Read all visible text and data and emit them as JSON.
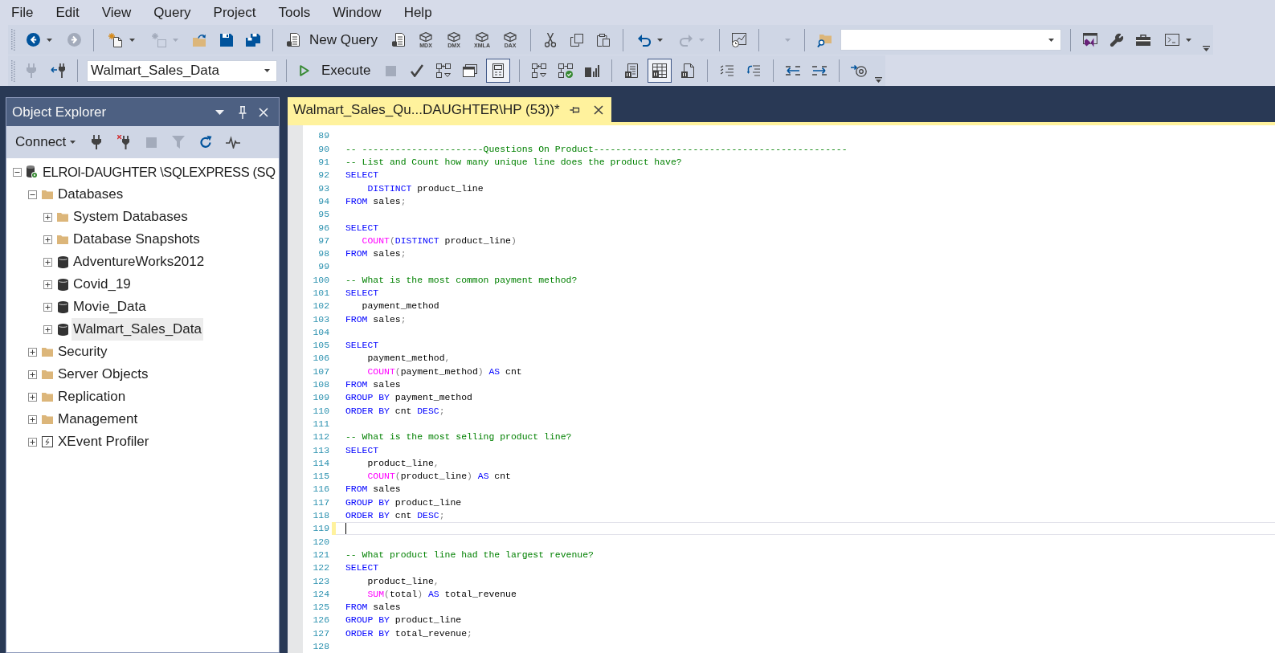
{
  "menu": [
    "File",
    "Edit",
    "View",
    "Query",
    "Project",
    "Tools",
    "Window",
    "Help"
  ],
  "toolbar_1": {
    "buttons": [
      {
        "disabled": false
      },
      {
        "disabled": true
      },
      {
        "disabled": false
      },
      {
        "disabled": true
      },
      {
        "disabled": false
      },
      {
        "disabled": false
      },
      {
        "disabled": false
      },
      {
        "disabled": false
      },
      {
        "disabled": false,
        "label": "MDX"
      },
      {
        "disabled": false,
        "label": "DMX"
      },
      {
        "disabled": false,
        "label": "XMLA"
      },
      {
        "disabled": false,
        "label": "DAX"
      },
      {
        "disabled": false
      },
      {
        "disabled": false
      },
      {
        "disabled": false
      },
      {
        "disabled": false
      },
      {
        "disabled": true
      },
      {
        "disabled": false
      },
      {
        "disabled": true
      },
      {
        "disabled": false
      },
      {
        "disabled": false
      },
      {
        "disabled": false
      },
      {
        "disabled": false
      },
      {
        "disabled": false
      }
    ],
    "new_query": {
      "label": "New Query"
    }
  },
  "toolbar_2": {
    "database": {
      "value": "Walmart_Sales_Data"
    },
    "execute": {
      "label": "Execute"
    },
    "buttons": [
      {
        "disabled": true,
        "pressed": false
      },
      {
        "disabled": false,
        "pressed": false
      },
      {
        "disabled": true,
        "pressed": false
      },
      {
        "disabled": false,
        "pressed": false
      },
      {
        "disabled": false,
        "pressed": false
      },
      {
        "disabled": false,
        "pressed": false
      },
      {
        "disabled": false,
        "pressed": true
      },
      {
        "disabled": false,
        "pressed": false
      },
      {
        "disabled": false,
        "pressed": false
      },
      {
        "disabled": false,
        "pressed": false
      },
      {
        "disabled": false,
        "pressed": false
      },
      {
        "disabled": false,
        "pressed": true
      },
      {
        "disabled": false,
        "pressed": false
      },
      {
        "disabled": false,
        "pressed": false
      },
      {
        "disabled": false,
        "pressed": false
      },
      {
        "disabled": false,
        "pressed": false
      },
      {
        "disabled": false,
        "pressed": false
      },
      {
        "disabled": false,
        "pressed": false
      }
    ]
  },
  "object_explorer": {
    "title": "Object Explorer",
    "connect": {
      "label": "Connect"
    },
    "buttons": [
      {
        "disabled": false
      },
      {
        "disabled": false
      },
      {
        "disabled": true
      },
      {
        "disabled": true
      },
      {
        "disabled": false
      },
      {
        "disabled": false
      }
    ],
    "tree": [
      {
        "label": "ELROI-DAUGHTER \\SQLEXPRESS (SQ",
        "kind": "server",
        "expanded": true,
        "selected": false,
        "children": [
          {
            "label": "Databases",
            "kind": "folder",
            "expanded": true,
            "selected": false,
            "children": [
              {
                "label": "System Databases",
                "kind": "folder",
                "expanded": false,
                "selected": false
              },
              {
                "label": "Database Snapshots",
                "kind": "folder",
                "expanded": false,
                "selected": false
              },
              {
                "label": "AdventureWorks2012",
                "kind": "database",
                "expanded": false,
                "selected": false
              },
              {
                "label": "Covid_19",
                "kind": "database",
                "expanded": false,
                "selected": false
              },
              {
                "label": "Movie_Data",
                "kind": "database",
                "expanded": false,
                "selected": false
              },
              {
                "label": "Walmart_Sales_Data",
                "kind": "database",
                "expanded": false,
                "selected": true
              }
            ]
          },
          {
            "label": "Security",
            "kind": "folder",
            "expanded": false,
            "selected": false
          },
          {
            "label": "Server Objects",
            "kind": "folder",
            "expanded": false,
            "selected": false
          },
          {
            "label": "Replication",
            "kind": "folder",
            "expanded": false,
            "selected": false
          },
          {
            "label": "Management",
            "kind": "folder",
            "expanded": false,
            "selected": false
          },
          {
            "label": "XEvent Profiler",
            "kind": "profiler",
            "expanded": false,
            "selected": false
          }
        ]
      }
    ]
  },
  "editor": {
    "tab": {
      "title": "Walmart_Sales_Qu...DAUGHTER\\HP (53))*"
    },
    "lines": [
      {
        "number": "89",
        "current": false,
        "modified": false
      },
      {
        "number": "90",
        "current": false,
        "modified": false,
        "tokens": [
          {
            "kind": "comment",
            "text": "-- ----------------------Questions On Product----------------------------------------------"
          }
        ]
      },
      {
        "number": "91",
        "current": false,
        "modified": false,
        "tokens": [
          {
            "kind": "comment",
            "text": "-- List and Count how many unique line does the product have?"
          }
        ]
      },
      {
        "number": "92",
        "current": false,
        "modified": false,
        "tokens": [
          {
            "kind": "keyword",
            "text": "SELECT"
          }
        ]
      },
      {
        "number": "93",
        "current": false,
        "modified": false,
        "tokens": [
          {
            "kind": "keyword",
            "text": "    DISTINCT"
          },
          {
            "kind": "plain",
            "text": " product_line"
          }
        ]
      },
      {
        "number": "94",
        "current": false,
        "modified": false,
        "tokens": [
          {
            "kind": "keyword",
            "text": "FROM"
          },
          {
            "kind": "plain",
            "text": " sales"
          },
          {
            "kind": "operator",
            "text": ";"
          }
        ]
      },
      {
        "number": "95",
        "current": false,
        "modified": false
      },
      {
        "number": "96",
        "current": false,
        "modified": false,
        "tokens": [
          {
            "kind": "keyword",
            "text": "SELECT"
          }
        ]
      },
      {
        "number": "97",
        "current": false,
        "modified": false,
        "tokens": [
          {
            "kind": "function",
            "text": "   COUNT"
          },
          {
            "kind": "operator",
            "text": "("
          },
          {
            "kind": "keyword",
            "text": "DISTINCT"
          },
          {
            "kind": "plain",
            "text": " product_line"
          },
          {
            "kind": "operator",
            "text": ")"
          }
        ]
      },
      {
        "number": "98",
        "current": false,
        "modified": false,
        "tokens": [
          {
            "kind": "keyword",
            "text": "FROM"
          },
          {
            "kind": "plain",
            "text": " sales"
          },
          {
            "kind": "operator",
            "text": ";"
          }
        ]
      },
      {
        "number": "99",
        "current": false,
        "modified": false
      },
      {
        "number": "100",
        "current": false,
        "modified": false,
        "tokens": [
          {
            "kind": "comment",
            "text": "-- What is the most common payment method?"
          }
        ]
      },
      {
        "number": "101",
        "current": false,
        "modified": false,
        "tokens": [
          {
            "kind": "keyword",
            "text": "SELECT"
          }
        ]
      },
      {
        "number": "102",
        "current": false,
        "modified": false,
        "tokens": [
          {
            "kind": "plain",
            "text": "   payment_method"
          }
        ]
      },
      {
        "number": "103",
        "current": false,
        "modified": false,
        "tokens": [
          {
            "kind": "keyword",
            "text": "FROM"
          },
          {
            "kind": "plain",
            "text": " sales"
          },
          {
            "kind": "operator",
            "text": ";"
          }
        ]
      },
      {
        "number": "104",
        "current": false,
        "modified": false
      },
      {
        "number": "105",
        "current": false,
        "modified": false,
        "tokens": [
          {
            "kind": "keyword",
            "text": "SELECT"
          }
        ]
      },
      {
        "number": "106",
        "current": false,
        "modified": false,
        "tokens": [
          {
            "kind": "plain",
            "text": "    payment_method"
          },
          {
            "kind": "operator",
            "text": ","
          }
        ]
      },
      {
        "number": "107",
        "current": false,
        "modified": false,
        "tokens": [
          {
            "kind": "function",
            "text": "    COUNT"
          },
          {
            "kind": "operator",
            "text": "("
          },
          {
            "kind": "plain",
            "text": "payment_method"
          },
          {
            "kind": "operator",
            "text": ")"
          },
          {
            "kind": "keyword",
            "text": " AS"
          },
          {
            "kind": "plain",
            "text": " cnt"
          }
        ]
      },
      {
        "number": "108",
        "current": false,
        "modified": false,
        "tokens": [
          {
            "kind": "keyword",
            "text": "FROM"
          },
          {
            "kind": "plain",
            "text": " sales"
          }
        ]
      },
      {
        "number": "109",
        "current": false,
        "modified": false,
        "tokens": [
          {
            "kind": "keyword",
            "text": "GROUP BY"
          },
          {
            "kind": "plain",
            "text": " payment_method"
          }
        ]
      },
      {
        "number": "110",
        "current": false,
        "modified": false,
        "tokens": [
          {
            "kind": "keyword",
            "text": "ORDER BY"
          },
          {
            "kind": "plain",
            "text": " cnt"
          },
          {
            "kind": "keyword",
            "text": " DESC"
          },
          {
            "kind": "operator",
            "text": ";"
          }
        ]
      },
      {
        "number": "111",
        "current": false,
        "modified": false
      },
      {
        "number": "112",
        "current": false,
        "modified": false,
        "tokens": [
          {
            "kind": "comment",
            "text": "-- What is the most selling product line?"
          }
        ]
      },
      {
        "number": "113",
        "current": false,
        "modified": false,
        "tokens": [
          {
            "kind": "keyword",
            "text": "SELECT"
          }
        ]
      },
      {
        "number": "114",
        "current": false,
        "modified": false,
        "tokens": [
          {
            "kind": "plain",
            "text": "    product_line"
          },
          {
            "kind": "operator",
            "text": ","
          }
        ]
      },
      {
        "number": "115",
        "current": false,
        "modified": false,
        "tokens": [
          {
            "kind": "function",
            "text": "    COUNT"
          },
          {
            "kind": "operator",
            "text": "("
          },
          {
            "kind": "plain",
            "text": "product_line"
          },
          {
            "kind": "operator",
            "text": ")"
          },
          {
            "kind": "keyword",
            "text": " AS"
          },
          {
            "kind": "plain",
            "text": " cnt"
          }
        ]
      },
      {
        "number": "116",
        "current": false,
        "modified": false,
        "tokens": [
          {
            "kind": "keyword",
            "text": "FROM"
          },
          {
            "kind": "plain",
            "text": " sales"
          }
        ]
      },
      {
        "number": "117",
        "current": false,
        "modified": false,
        "tokens": [
          {
            "kind": "keyword",
            "text": "GROUP BY"
          },
          {
            "kind": "plain",
            "text": " product_line"
          }
        ]
      },
      {
        "number": "118",
        "current": false,
        "modified": false,
        "tokens": [
          {
            "kind": "keyword",
            "text": "ORDER BY"
          },
          {
            "kind": "plain",
            "text": " cnt"
          },
          {
            "kind": "keyword",
            "text": " DESC"
          },
          {
            "kind": "operator",
            "text": ";"
          }
        ]
      },
      {
        "number": "119",
        "current": true,
        "modified": true
      },
      {
        "number": "120",
        "current": false,
        "modified": false
      },
      {
        "number": "121",
        "current": false,
        "modified": false,
        "tokens": [
          {
            "kind": "comment",
            "text": "-- What product line had the largest revenue?"
          }
        ]
      },
      {
        "number": "122",
        "current": false,
        "modified": false,
        "tokens": [
          {
            "kind": "keyword",
            "text": "SELECT"
          }
        ]
      },
      {
        "number": "123",
        "current": false,
        "modified": false,
        "tokens": [
          {
            "kind": "plain",
            "text": "    product_line"
          },
          {
            "kind": "operator",
            "text": ","
          }
        ]
      },
      {
        "number": "124",
        "current": false,
        "modified": false,
        "tokens": [
          {
            "kind": "function",
            "text": "    SUM"
          },
          {
            "kind": "operator",
            "text": "("
          },
          {
            "kind": "plain",
            "text": "total"
          },
          {
            "kind": "operator",
            "text": ")"
          },
          {
            "kind": "keyword",
            "text": " AS"
          },
          {
            "kind": "plain",
            "text": " total_revenue"
          }
        ]
      },
      {
        "number": "125",
        "current": false,
        "modified": false,
        "tokens": [
          {
            "kind": "keyword",
            "text": "FROM"
          },
          {
            "kind": "plain",
            "text": " sales"
          }
        ]
      },
      {
        "number": "126",
        "current": false,
        "modified": false,
        "tokens": [
          {
            "kind": "keyword",
            "text": "GROUP BY"
          },
          {
            "kind": "plain",
            "text": " product_line"
          }
        ]
      },
      {
        "number": "127",
        "current": false,
        "modified": false,
        "tokens": [
          {
            "kind": "keyword",
            "text": "ORDER BY"
          },
          {
            "kind": "plain",
            "text": " total_revenue"
          },
          {
            "kind": "operator",
            "text": ";"
          }
        ]
      },
      {
        "number": "128",
        "current": false,
        "modified": false
      }
    ]
  }
}
